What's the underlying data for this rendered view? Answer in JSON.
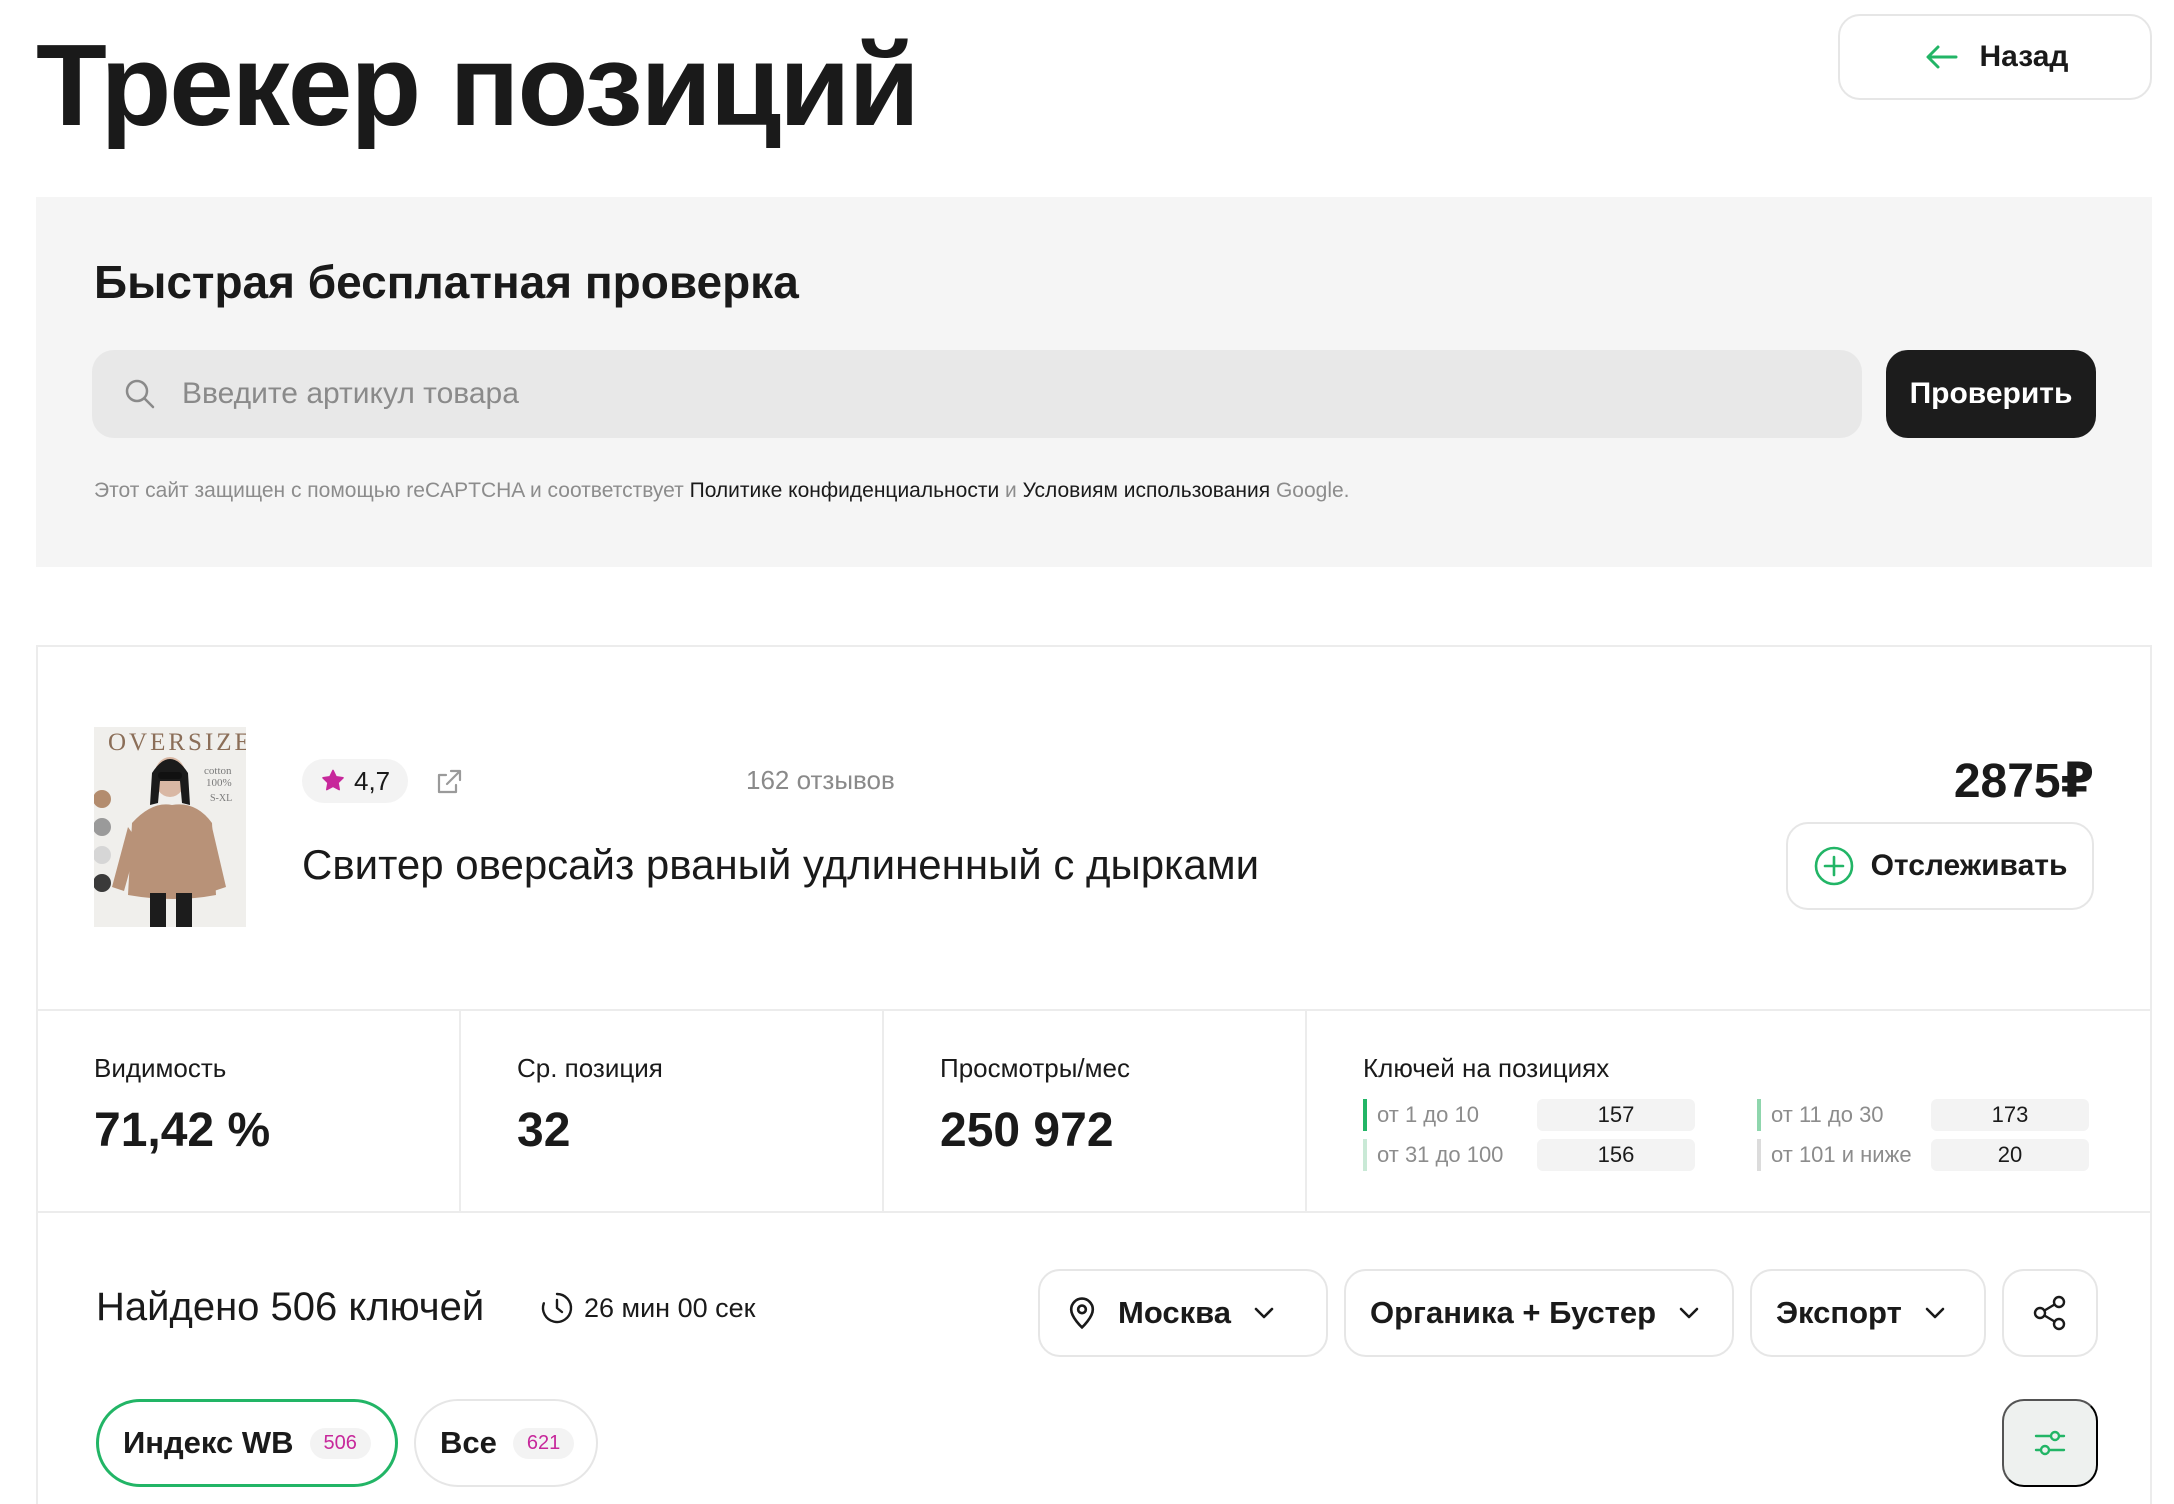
{
  "page": {
    "title": "Трекер позиций",
    "back_label": "Назад"
  },
  "quick_check": {
    "title": "Быстрая бесплатная проверка",
    "search_placeholder": "Введите артикул товара",
    "search_value": "",
    "submit_label": "Проверить",
    "captcha_prefix": "Этот сайт защищен с помощью reCAPTCHA и соответствует ",
    "privacy_link": "Политике конфиденциальности",
    "and_word": " и ",
    "terms_link": "Условиям использования",
    "google_suffix": " Google."
  },
  "product": {
    "image_label": "OVERSIZE",
    "image_sub": [
      "cotton",
      "100%",
      "S-XL"
    ],
    "rating": "4,7",
    "reviews": "162 отзывов",
    "price": "2875₽",
    "title": "Свитер оверсайз рваный удлиненный с дырками",
    "track_label": "Отслеживать"
  },
  "metrics": {
    "visibility": {
      "label": "Видимость",
      "value": "71,42 %"
    },
    "avg_position": {
      "label": "Ср. позиция",
      "value": "32"
    },
    "views": {
      "label": "Просмотры/мес",
      "value": "250 972"
    },
    "keys": {
      "label": "Ключей на позициях",
      "ranges": [
        {
          "label": "от 1 до 10",
          "value": "157"
        },
        {
          "label": "от 11 до 30",
          "value": "173"
        },
        {
          "label": "от 31 до 100",
          "value": "156"
        },
        {
          "label": "от 101 и ниже",
          "value": "20"
        }
      ]
    }
  },
  "results": {
    "found": "Найдено 506 ключей",
    "timer": "26 мин 00 сек",
    "city": "Москва",
    "source": "Органика + Бустер",
    "export": "Экспорт",
    "tabs": [
      {
        "label": "Индекс WB",
        "count": "506"
      },
      {
        "label": "Все",
        "count": "621"
      }
    ]
  },
  "colors": {
    "accent": "#22b566",
    "rating_star": "#c7289b",
    "dark_button": "#1c1c1c"
  }
}
